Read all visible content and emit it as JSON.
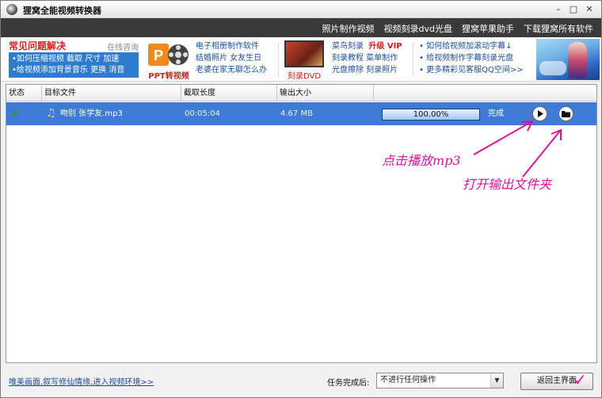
{
  "window": {
    "title": "狸窝全能视频转换器",
    "controls": {
      "minimize": "–",
      "maximize": "□",
      "close": "✕"
    }
  },
  "topbar": {
    "links": [
      "照片制作视频",
      "视频刻录dvd光盘",
      "狸窝苹果助手",
      "下载狸窝所有软件"
    ]
  },
  "ad": {
    "faq_title": "常见问题解决",
    "faq_consult": "在线咨询",
    "faq_lines": [
      "•如何压缩视频  截取  尺寸  加速",
      "•给视频添加背景音乐  更换  消音"
    ],
    "ppt_label": "PPT转视频",
    "col1": [
      "电子相册制作软件",
      "结婚照片  女友生日",
      "老婆在家无聊怎么办"
    ],
    "dvd_label": "刻录DVD",
    "col2_line1_a": "菜鸟刻录",
    "col2_line1_b": "升级 VIP",
    "col2_lines": [
      "刻录教程  菜单制作",
      "光盘擦除  刻录照片"
    ],
    "col3": [
      "• 如何给视频加滚动字幕↓",
      "• 给视频制作字幕刻录光盘",
      "• 更多精彩见客服QQ空间>>"
    ]
  },
  "table": {
    "headers": [
      "状态",
      "目标文件",
      "截取长度",
      "输出大小",
      ""
    ],
    "rows": [
      {
        "status_icon": "check-icon",
        "file_icon": "music-note-icon",
        "file": "吻别 张学友.mp3",
        "duration": "00:05:04",
        "size": "4.67 MB",
        "progress_percent": 100,
        "progress_text": "100.00%",
        "state": "完成"
      }
    ]
  },
  "annotations": {
    "play_hint": "点击播放mp3",
    "folder_hint": "打开输出文件夹"
  },
  "footer": {
    "link": "唯美画面,叙写修仙情缘,进入视频环境>>",
    "after_label": "任务完成后:",
    "after_value": "不进行任何操作",
    "back_button": "返回主界面"
  },
  "colors": {
    "selected_row": "#3d7bd6",
    "annotation": "#e0119a",
    "link": "#1a4e9a"
  }
}
